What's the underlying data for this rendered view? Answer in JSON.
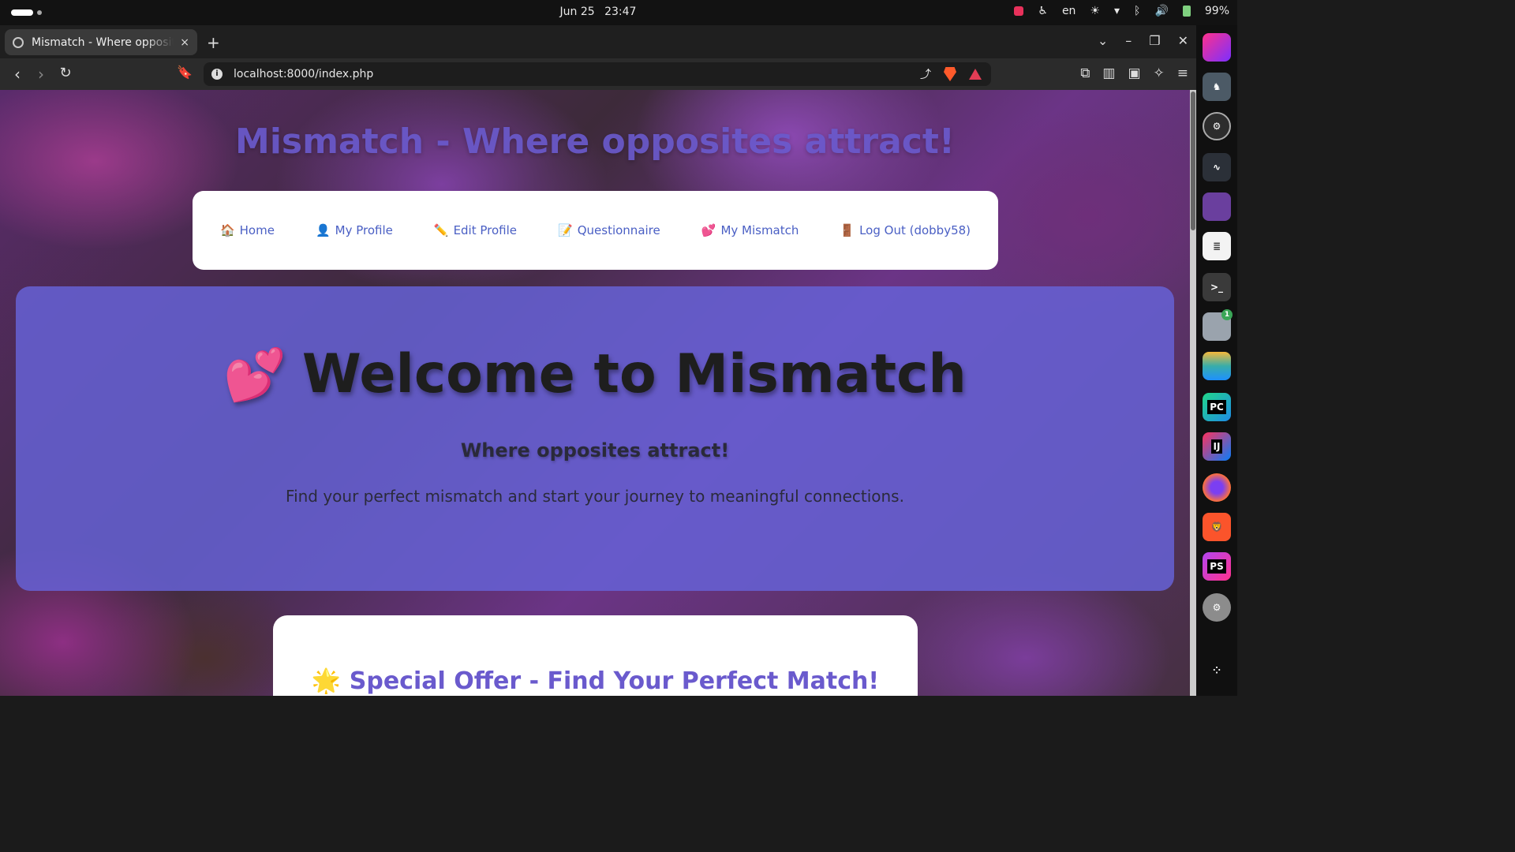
{
  "system": {
    "date": "Jun 25",
    "time": "23:47",
    "language": "en",
    "battery": "99%"
  },
  "browser": {
    "tab_title": "Mismatch - Where opposites attract!",
    "new_tab": "+",
    "tab_close": "×",
    "url": "localhost:8000/index.php",
    "window_controls": [
      "⌄",
      "–",
      "❐",
      "✕"
    ]
  },
  "page": {
    "site_title": "Mismatch - Where opposites attract!",
    "nav": [
      {
        "icon": "🏠",
        "label": "Home"
      },
      {
        "icon": "👤",
        "label": "My Profile"
      },
      {
        "icon": "✏️",
        "label": "Edit Profile"
      },
      {
        "icon": "📝",
        "label": "Questionnaire"
      },
      {
        "icon": "💕",
        "label": "My Mismatch"
      },
      {
        "icon": "🚪",
        "label": "Log Out (dobby58)"
      }
    ],
    "hero": {
      "icon": "💕",
      "heading": "Welcome to Mismatch",
      "subheading": "Where opposites attract!",
      "text": "Find your perfect mismatch and start your journey to meaningful connections."
    },
    "offer": {
      "icon": "🌟",
      "title": "Special Offer - Find Your Perfect Match!"
    }
  },
  "dock": {
    "items": [
      "jetbrains-toolbox",
      "horse-app",
      "settings-app",
      "system-monitor",
      "text-editor",
      "document-viewer",
      "terminal",
      "files",
      "layers-app",
      "pycharm",
      "intellij",
      "firefox",
      "brave",
      "phpstorm",
      "settings",
      "app-grid"
    ],
    "files_badge": "1",
    "pycharm_label": "PC",
    "intellij_label": "IJ",
    "phpstorm_label": "PS"
  },
  "colors": {
    "accent": "#6a5acd",
    "nav_link": "#4a5fc4",
    "hero_bg": "#6662d6"
  }
}
